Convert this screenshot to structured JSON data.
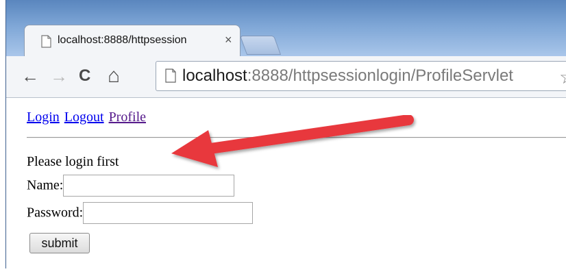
{
  "browser": {
    "tab": {
      "title": "localhost:8888/httpsession",
      "close_glyph": "×",
      "favicon": "page-icon"
    },
    "toolbar": {
      "back_glyph": "←",
      "forward_glyph": "→",
      "reload_glyph": "C",
      "home_glyph": "⌂",
      "url_host": "localhost",
      "url_rest": ":8888/httpsessionlogin/ProfileServlet",
      "star_glyph": "☆",
      "page_icon": "page-icon"
    }
  },
  "page": {
    "nav": {
      "login": "Login",
      "logout": "Logout",
      "profile": "Profile"
    },
    "message": "Please login first",
    "form": {
      "name_label": "Name:",
      "name_value": "",
      "password_label": "Password:",
      "password_value": "",
      "submit_label": "submit"
    }
  },
  "annotation": {
    "arrow_color": "#e8373c",
    "pointing_at": "message"
  },
  "colors": {
    "link": "#0000ee",
    "link_visited": "#551a8b",
    "titlebar": "#6c95c6"
  }
}
